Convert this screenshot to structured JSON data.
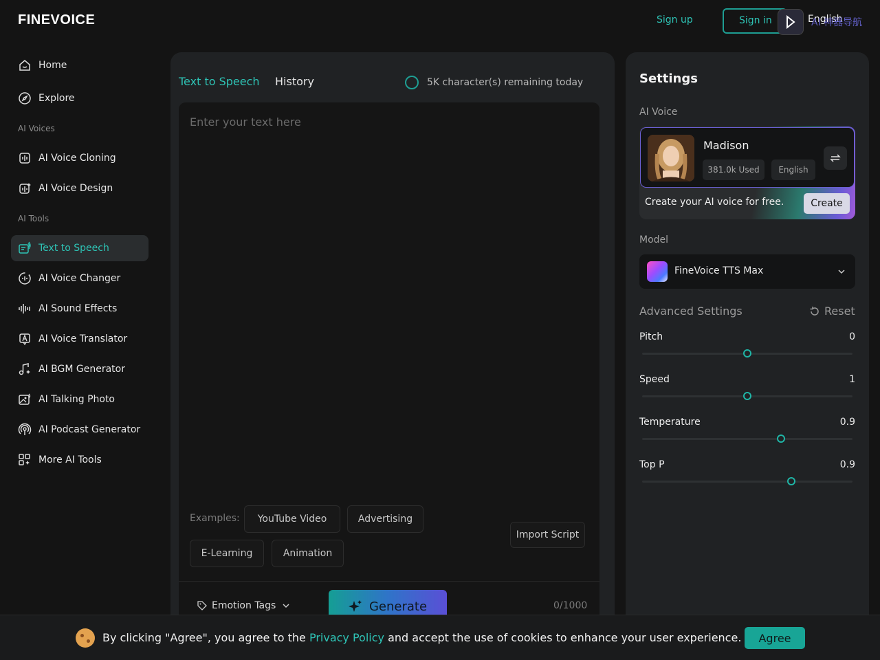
{
  "header": {
    "logo": "FINEVOICE",
    "signup": "Sign up",
    "signin": "Sign in",
    "language": "English",
    "watermark": "AI 神器导航"
  },
  "sidebar": {
    "items": [
      {
        "label": "Home",
        "icon": "home-icon"
      },
      {
        "label": "Explore",
        "icon": "compass-icon"
      }
    ],
    "section_voices": "AI Voices",
    "voices": [
      {
        "label": "AI Voice Cloning",
        "icon": "voice-clone-icon"
      },
      {
        "label": "AI Voice Design",
        "icon": "voice-design-icon"
      }
    ],
    "section_tools": "AI Tools",
    "tools": [
      {
        "label": "Text to Speech",
        "icon": "text-to-speech-icon",
        "active": true
      },
      {
        "label": "AI Voice Changer",
        "icon": "voice-changer-icon"
      },
      {
        "label": "AI Sound Effects",
        "icon": "sound-effects-icon"
      },
      {
        "label": "AI Voice Translator",
        "icon": "translator-icon"
      },
      {
        "label": "AI BGM Generator",
        "icon": "music-note-icon"
      },
      {
        "label": "AI Talking Photo",
        "icon": "talking-photo-icon"
      },
      {
        "label": "AI Podcast Generator",
        "icon": "podcast-icon"
      },
      {
        "label": "More AI Tools",
        "icon": "grid-icon"
      }
    ]
  },
  "main": {
    "tab_tts": "Text to Speech",
    "tab_history": "History",
    "remaining": "5K character(s) remaining today",
    "placeholder": "Enter your text here",
    "examples_label": "Examples:",
    "examples": [
      "YouTube Video",
      "Advertising",
      "E-Learning",
      "Animation"
    ],
    "import_script": "Import Script",
    "emotion_tags": "Emotion Tags",
    "generate": "Generate",
    "counter": "0/1000"
  },
  "settings": {
    "title": "Settings",
    "ai_voice_label": "AI Voice",
    "voice": {
      "name": "Madison",
      "used": "381.0k Used",
      "language": "English"
    },
    "promo_text": "Create your AI voice for free.",
    "create": "Create",
    "model_label": "Model",
    "model": "FineVoice TTS Max",
    "advanced": "Advanced Settings",
    "reset": "Reset",
    "sliders": [
      {
        "label": "Pitch",
        "value": "0",
        "fraction": 0.5
      },
      {
        "label": "Speed",
        "value": "1",
        "fraction": 0.5
      },
      {
        "label": "Temperature",
        "value": "0.9",
        "fraction": 0.66
      },
      {
        "label": "Top P",
        "value": "0.9",
        "fraction": 0.71
      }
    ]
  },
  "cookie": {
    "text_before": "By clicking \"Agree\", you agree to the ",
    "link": "Privacy Policy",
    "text_after": " and accept the use of cookies to enhance your user experience.",
    "agree": "Agree"
  },
  "colors": {
    "accent": "#2ec4b6",
    "background": "#141414",
    "panel": "#202224"
  }
}
